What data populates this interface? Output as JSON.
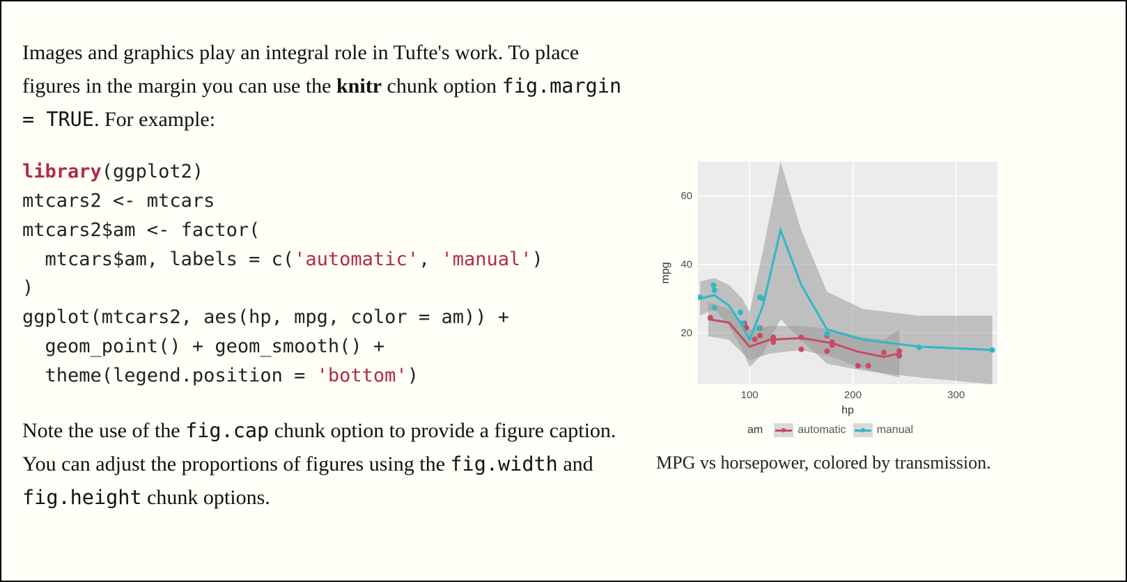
{
  "prose": {
    "p1a": "Images and graphics play an integral role in Tufte's work. To place figures in the margin you can use the ",
    "p1_bold": "knitr",
    "p1b": " chunk option ",
    "p1_code": "fig.margin = TRUE",
    "p1c": ". For example:",
    "p2a": "Note the use of the ",
    "p2_code1": "fig.cap",
    "p2b": " chunk option to provide a figure caption. You can adjust the proportions of figures using the ",
    "p2_code2": "fig.width",
    "p2c": " and ",
    "p2_code3": "fig.height",
    "p2d": " chunk options."
  },
  "code": {
    "l1_kw": "library",
    "l1_rest": "(ggplot2)",
    "l2": "mtcars2 <- mtcars",
    "l3": "mtcars2$am <- factor(",
    "l4a": "  mtcars$am, labels = c(",
    "l4s1": "'automatic'",
    "l4b": ", ",
    "l4s2": "'manual'",
    "l4c": ")",
    "l5": ")",
    "l6": "ggplot(mtcars2, aes(hp, mpg, color = am)) +",
    "l7": "  geom_point() + geom_smooth() +",
    "l8a": "  theme(legend.position = ",
    "l8s": "'bottom'",
    "l8b": ")"
  },
  "figure": {
    "caption": "MPG vs horsepower, colored by transmission.",
    "xlabel": "hp",
    "ylabel": "mpg",
    "legend_title": "am",
    "legend_auto": "automatic",
    "legend_manual": "manual",
    "yticks": {
      "t20": "20",
      "t40": "40",
      "t60": "60"
    },
    "xticks": {
      "t100": "100",
      "t200": "200",
      "t300": "300"
    }
  },
  "chart_data": {
    "type": "line",
    "title": "",
    "xlabel": "hp",
    "ylabel": "mpg",
    "xlim": [
      50,
      340
    ],
    "ylim": [
      5,
      70
    ],
    "legend": {
      "title": "am",
      "position": "bottom"
    },
    "series": [
      {
        "name": "automatic",
        "color": "#c84b64",
        "smooth": [
          {
            "x": 60,
            "y": 24
          },
          {
            "x": 80,
            "y": 23
          },
          {
            "x": 100,
            "y": 16
          },
          {
            "x": 120,
            "y": 18
          },
          {
            "x": 150,
            "y": 18.5
          },
          {
            "x": 180,
            "y": 17
          },
          {
            "x": 205,
            "y": 14.5
          },
          {
            "x": 230,
            "y": 13
          },
          {
            "x": 245,
            "y": 14
          }
        ],
        "ribbon": [
          {
            "x": 60,
            "lo": 19,
            "hi": 29
          },
          {
            "x": 80,
            "lo": 18,
            "hi": 27
          },
          {
            "x": 100,
            "lo": 12,
            "hi": 21
          },
          {
            "x": 120,
            "lo": 14,
            "hi": 22
          },
          {
            "x": 150,
            "lo": 15,
            "hi": 22
          },
          {
            "x": 180,
            "lo": 13,
            "hi": 21
          },
          {
            "x": 205,
            "lo": 10,
            "hi": 19
          },
          {
            "x": 230,
            "lo": 8,
            "hi": 18
          },
          {
            "x": 245,
            "lo": 7,
            "hi": 21
          }
        ],
        "points": [
          {
            "x": 62,
            "y": 24.4
          },
          {
            "x": 95,
            "y": 22.8
          },
          {
            "x": 97,
            "y": 21.5
          },
          {
            "x": 105,
            "y": 18.1
          },
          {
            "x": 110,
            "y": 21.4
          },
          {
            "x": 110,
            "y": 19.2
          },
          {
            "x": 123,
            "y": 18.7
          },
          {
            "x": 123,
            "y": 17.3
          },
          {
            "x": 150,
            "y": 15.2
          },
          {
            "x": 150,
            "y": 18.7
          },
          {
            "x": 175,
            "y": 19.2
          },
          {
            "x": 175,
            "y": 14.7
          },
          {
            "x": 180,
            "y": 16.4
          },
          {
            "x": 180,
            "y": 17.3
          },
          {
            "x": 205,
            "y": 10.4
          },
          {
            "x": 215,
            "y": 10.4
          },
          {
            "x": 230,
            "y": 14.3
          },
          {
            "x": 245,
            "y": 13.3
          },
          {
            "x": 245,
            "y": 14.7
          }
        ]
      },
      {
        "name": "manual",
        "color": "#2fb8c5",
        "smooth": [
          {
            "x": 52,
            "y": 30
          },
          {
            "x": 66,
            "y": 31
          },
          {
            "x": 80,
            "y": 28
          },
          {
            "x": 93,
            "y": 22
          },
          {
            "x": 100,
            "y": 18
          },
          {
            "x": 113,
            "y": 28
          },
          {
            "x": 130,
            "y": 50
          },
          {
            "x": 150,
            "y": 34
          },
          {
            "x": 175,
            "y": 21
          },
          {
            "x": 210,
            "y": 18
          },
          {
            "x": 264,
            "y": 16
          },
          {
            "x": 335,
            "y": 15
          }
        ],
        "ribbon": [
          {
            "x": 52,
            "lo": 25,
            "hi": 35
          },
          {
            "x": 66,
            "lo": 27,
            "hi": 36
          },
          {
            "x": 80,
            "lo": 22,
            "hi": 34
          },
          {
            "x": 93,
            "lo": 15,
            "hi": 30
          },
          {
            "x": 100,
            "lo": 10,
            "hi": 26
          },
          {
            "x": 113,
            "lo": 14,
            "hi": 44
          },
          {
            "x": 130,
            "lo": 24,
            "hi": 70
          },
          {
            "x": 150,
            "lo": 18,
            "hi": 50
          },
          {
            "x": 175,
            "lo": 11,
            "hi": 32
          },
          {
            "x": 210,
            "lo": 9,
            "hi": 27
          },
          {
            "x": 264,
            "lo": 7,
            "hi": 25
          },
          {
            "x": 335,
            "lo": 5,
            "hi": 25
          }
        ],
        "points": [
          {
            "x": 52,
            "y": 30.4
          },
          {
            "x": 65,
            "y": 33.9
          },
          {
            "x": 66,
            "y": 32.4
          },
          {
            "x": 66,
            "y": 27.3
          },
          {
            "x": 91,
            "y": 26
          },
          {
            "x": 93,
            "y": 22.8
          },
          {
            "x": 109,
            "y": 21.4
          },
          {
            "x": 110,
            "y": 30.4
          },
          {
            "x": 113,
            "y": 30
          },
          {
            "x": 175,
            "y": 19.7
          },
          {
            "x": 264,
            "y": 15.8
          },
          {
            "x": 335,
            "y": 15
          }
        ]
      }
    ]
  }
}
